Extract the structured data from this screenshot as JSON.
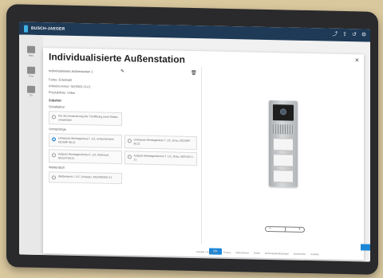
{
  "app": {
    "brand": "BUSCH-JAEGER",
    "titlebar_icons": [
      "share-icon",
      "upload-icon",
      "undo-icon",
      "settings-icon"
    ],
    "titlebar_glyphs": [
      "⤴",
      "⇪",
      "↺",
      "⚙"
    ],
    "sidebar": [
      {
        "label": "Hau",
        "icon": "home-icon"
      },
      {
        "label": "Pro",
        "icon": "project-icon"
      },
      {
        "label": "Ei",
        "icon": "device-icon"
      }
    ]
  },
  "dialog": {
    "title": "Individualisierte Außenstation",
    "close": "×",
    "station_name": "Individualisierte Außenstation 1",
    "info_lines": [
      "Farbe: Edelstahl",
      "Artikelnummer: M2X501-S-01",
      "Produktlinie: Video"
    ],
    "section_title": "Zubehör",
    "sections": [
      {
        "heading": "Schaltaktor",
        "options": [
          {
            "text": "Für die Ansteuerung der Türöffnung einer Relais verwenden",
            "selected": false
          }
        ]
      },
      {
        "heading": "Vorrsprünge",
        "options": [
          {
            "text": "Unterputz-Montagedose f. 1/2, einfach/mehrf. M2XMP-Bl.21",
            "selected": true
          },
          {
            "text": "Unterputz-Montagedose f. 1/2, Grau, M2XMP-Bl.21",
            "selected": false
          },
          {
            "text": "Aufputz-Montagerahmen f. 1/2, Anthrazit, M2XAT-Bl.21",
            "selected": false
          },
          {
            "text": "Aufputz-Montagerahmen f. 1/2, Grau, M2XAG-1-21",
            "selected": false
          }
        ]
      },
      {
        "heading": "Wetterdach",
        "options": [
          {
            "text": "Wetterdach f. 1/2, Schwarz, M2XWDMS-21",
            "selected": false
          }
        ]
      }
    ],
    "zoom_minus": "−",
    "zoom_plus": "+",
    "ok_label": "OK"
  },
  "footer": [
    "Kontakt / Impressum",
    "Privacy",
    "Datenschutz",
    "Sofort",
    "Nutzungsbedingungen",
    "Barrierefrei",
    "Cookies"
  ]
}
